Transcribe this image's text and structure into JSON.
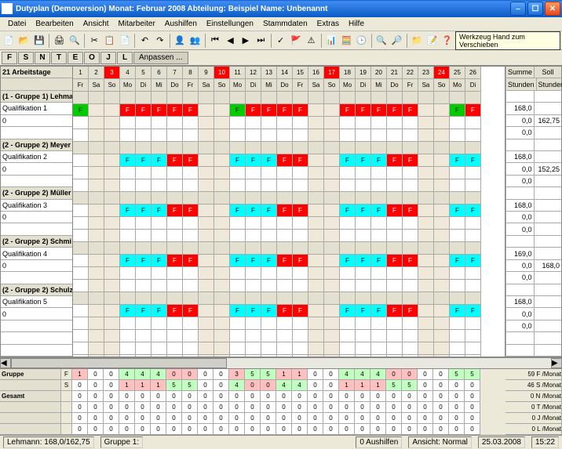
{
  "title": "Dutyplan (Demoversion)  Monat: Februar 2008  Abteilung: Beispiel  Name: Unbenannt",
  "menu": [
    "Datei",
    "Bearbeiten",
    "Ansicht",
    "Mitarbeiter",
    "Aushilfen",
    "Einstellungen",
    "Stammdaten",
    "Extras",
    "Hilfe"
  ],
  "toolbar_tip": "Werkzeug Hand zum Verschieben",
  "filters": [
    "F",
    "S",
    "N",
    "T",
    "E",
    "O",
    "J",
    "L",
    "Anpassen ..."
  ],
  "workdays_label": "21 Arbeitstage",
  "day_nums": [
    "1",
    "2",
    "3",
    "4",
    "5",
    "6",
    "7",
    "8",
    "9",
    "10",
    "11",
    "12",
    "13",
    "14",
    "15",
    "16",
    "17",
    "18",
    "19",
    "20",
    "21",
    "22",
    "23",
    "24",
    "25",
    "26"
  ],
  "day_wd": [
    "Fr",
    "Sa",
    "So",
    "Mo",
    "Di",
    "Mi",
    "Do",
    "Fr",
    "Sa",
    "So",
    "Mo",
    "Di",
    "Mi",
    "Do",
    "Fr",
    "Sa",
    "So",
    "Mo",
    "Di",
    "Mi",
    "Do",
    "Fr",
    "Sa",
    "So",
    "Mo",
    "Di"
  ],
  "day_red": [
    0,
    0,
    1,
    0,
    0,
    0,
    0,
    0,
    0,
    1,
    0,
    0,
    0,
    0,
    0,
    0,
    1,
    0,
    0,
    0,
    0,
    0,
    0,
    1,
    0,
    0
  ],
  "sum_hdr": [
    "Summe",
    "Soll"
  ],
  "hours_hdr_left": "Stunden",
  "hours_hdr_right": "Stunden",
  "groups": [
    {
      "name": "(1 - Gruppe 1) Lehma",
      "sum": "",
      "soll": "",
      "rows": [
        {
          "label": "Qualifikation 1",
          "cells": [
            "F",
            "",
            "",
            "F",
            "F",
            "F",
            "F",
            "F",
            "",
            "",
            "F",
            "F",
            "F",
            "F",
            "F",
            "",
            "",
            "F",
            "F",
            "F",
            "F",
            "F",
            "",
            "",
            "F",
            "F"
          ],
          "cls": [
            "green",
            "",
            "",
            "red",
            "red",
            "red",
            "red",
            "red",
            "",
            "",
            "green",
            "red",
            "red",
            "red",
            "red",
            "",
            "",
            "red",
            "red",
            "red",
            "red",
            "red",
            "",
            "",
            "green",
            "red"
          ],
          "sum": "168,0",
          "soll": ""
        },
        {
          "label": "0",
          "cells": [],
          "sum": "0,0",
          "soll": "162,75"
        },
        {
          "label": "",
          "cells": [],
          "sum": "0,0",
          "soll": ""
        }
      ]
    },
    {
      "name": "(2 - Gruppe 2) Meyer",
      "sum": "",
      "soll": "",
      "rows": [
        {
          "label": "Qualifikation 2",
          "cells": [
            "",
            "",
            "",
            "F",
            "F",
            "F",
            "F",
            "F",
            "",
            "",
            "F",
            "F",
            "F",
            "F",
            "F",
            "",
            "",
            "F",
            "F",
            "F",
            "F",
            "F",
            "",
            "",
            "F",
            "F"
          ],
          "cls": [
            "",
            "",
            "",
            "cyan",
            "cyan",
            "cyan",
            "red",
            "red",
            "",
            "",
            "cyan",
            "cyan",
            "cyan",
            "red",
            "red",
            "",
            "",
            "cyan",
            "cyan",
            "cyan",
            "red",
            "red",
            "",
            "",
            "cyan",
            "cyan"
          ],
          "sum": "168,0",
          "soll": ""
        },
        {
          "label": "0",
          "cells": [],
          "sum": "0,0",
          "soll": "152,25"
        },
        {
          "label": "",
          "cells": [],
          "sum": "0,0",
          "soll": ""
        }
      ]
    },
    {
      "name": "(2 - Gruppe 2) Müller",
      "sum": "",
      "soll": "",
      "rows": [
        {
          "label": "Qualifikation 3",
          "cells": [
            "",
            "",
            "",
            "F",
            "F",
            "F",
            "F",
            "F",
            "",
            "",
            "F",
            "F",
            "F",
            "F",
            "F",
            "",
            "",
            "F",
            "F",
            "F",
            "F",
            "F",
            "",
            "",
            "F",
            "F"
          ],
          "cls": [
            "",
            "",
            "",
            "cyan",
            "cyan",
            "cyan",
            "red",
            "red",
            "",
            "",
            "cyan",
            "cyan",
            "cyan",
            "red",
            "red",
            "",
            "",
            "cyan",
            "cyan",
            "cyan",
            "red",
            "red",
            "",
            "",
            "cyan",
            "cyan"
          ],
          "sum": "168,0",
          "soll": ""
        },
        {
          "label": "0",
          "cells": [],
          "sum": "0,0",
          "soll": ""
        },
        {
          "label": "",
          "cells": [],
          "sum": "0,0",
          "soll": ""
        }
      ]
    },
    {
      "name": "(2 - Gruppe 2) Schmi",
      "sum": "",
      "soll": "",
      "rows": [
        {
          "label": "Qualifikation 4",
          "cells": [
            "",
            "",
            "",
            "F",
            "F",
            "F",
            "F",
            "F",
            "",
            "",
            "F",
            "F",
            "F",
            "F",
            "F",
            "",
            "",
            "F",
            "F",
            "F",
            "F",
            "F",
            "",
            "",
            "F",
            "F"
          ],
          "cls": [
            "",
            "",
            "",
            "cyan",
            "cyan",
            "cyan",
            "red",
            "red",
            "",
            "",
            "cyan",
            "cyan",
            "cyan",
            "red",
            "red",
            "",
            "",
            "cyan",
            "cyan",
            "cyan",
            "red",
            "red",
            "",
            "",
            "cyan",
            "cyan"
          ],
          "sum": "169,0",
          "soll": ""
        },
        {
          "label": "0",
          "cells": [],
          "sum": "0,0",
          "soll": "168,0"
        },
        {
          "label": "",
          "cells": [],
          "sum": "0,0",
          "soll": ""
        }
      ]
    },
    {
      "name": "(2 - Gruppe 2) Schulz",
      "sum": "",
      "soll": "",
      "rows": [
        {
          "label": "Qualifikation 5",
          "cells": [
            "",
            "",
            "",
            "F",
            "F",
            "F",
            "F",
            "F",
            "",
            "",
            "F",
            "F",
            "F",
            "F",
            "F",
            "",
            "",
            "F",
            "F",
            "F",
            "F",
            "F",
            "",
            "",
            "F",
            "F"
          ],
          "cls": [
            "",
            "",
            "",
            "cyan",
            "cyan",
            "cyan",
            "red",
            "red",
            "",
            "",
            "cyan",
            "cyan",
            "cyan",
            "red",
            "red",
            "",
            "",
            "cyan",
            "cyan",
            "cyan",
            "red",
            "red",
            "",
            "",
            "cyan",
            "cyan"
          ],
          "sum": "168,0",
          "soll": ""
        },
        {
          "label": "0",
          "cells": [],
          "sum": "0,0",
          "soll": ""
        },
        {
          "label": "",
          "cells": [],
          "sum": "0,0",
          "soll": ""
        },
        {
          "label": "",
          "cells": [],
          "sum": "",
          "soll": ""
        },
        {
          "label": "",
          "cells": [],
          "sum": "",
          "soll": ""
        }
      ]
    }
  ],
  "summary": {
    "labels": [
      "Gruppe",
      "",
      "Gesamt",
      "",
      "",
      ""
    ],
    "codes": [
      "F",
      "S"
    ],
    "grid": [
      {
        "label": "F",
        "vals": [
          "1",
          "0",
          "0",
          "4",
          "4",
          "4",
          "0",
          "0",
          "0",
          "0",
          "3",
          "5",
          "5",
          "1",
          "1",
          "0",
          "0",
          "4",
          "4",
          "4",
          "0",
          "0",
          "0",
          "0",
          "5",
          "5"
        ],
        "cls": [
          "pink",
          "",
          "",
          "lgreen",
          "lgreen",
          "lgreen",
          "pink",
          "pink",
          "",
          "",
          "pink",
          "lgreen",
          "lgreen",
          "pink",
          "pink",
          "",
          "",
          "lgreen",
          "lgreen",
          "lgreen",
          "pink",
          "pink",
          "",
          "",
          "lgreen",
          "lgreen"
        ],
        "right": "59 F /Monat"
      },
      {
        "label": "S",
        "vals": [
          "0",
          "0",
          "0",
          "1",
          "1",
          "1",
          "5",
          "5",
          "0",
          "0",
          "4",
          "0",
          "0",
          "4",
          "4",
          "0",
          "0",
          "1",
          "1",
          "1",
          "5",
          "5",
          "0",
          "0",
          "0",
          "0"
        ],
        "cls": [
          "",
          "",
          "",
          "pink",
          "pink",
          "pink",
          "lgreen",
          "lgreen",
          "",
          "",
          "lgreen",
          "pink",
          "pink",
          "lgreen",
          "lgreen",
          "",
          "",
          "pink",
          "pink",
          "pink",
          "lgreen",
          "lgreen",
          "",
          "",
          "",
          ""
        ],
        "right": "46 S /Monat"
      },
      {
        "label": "",
        "vals": [
          "0",
          "0",
          "0",
          "0",
          "0",
          "0",
          "0",
          "0",
          "0",
          "0",
          "0",
          "0",
          "0",
          "0",
          "0",
          "0",
          "0",
          "0",
          "0",
          "0",
          "0",
          "0",
          "0",
          "0",
          "0",
          "0"
        ],
        "cls": [],
        "right": "0 N /Monat"
      },
      {
        "label": "",
        "vals": [
          "0",
          "0",
          "0",
          "0",
          "0",
          "0",
          "0",
          "0",
          "0",
          "0",
          "0",
          "0",
          "0",
          "0",
          "0",
          "0",
          "0",
          "0",
          "0",
          "0",
          "0",
          "0",
          "0",
          "0",
          "0",
          "0"
        ],
        "cls": [],
        "right": "0 T /Monat"
      },
      {
        "label": "",
        "vals": [
          "0",
          "0",
          "0",
          "0",
          "0",
          "0",
          "0",
          "0",
          "0",
          "0",
          "0",
          "0",
          "0",
          "0",
          "0",
          "0",
          "0",
          "0",
          "0",
          "0",
          "0",
          "0",
          "0",
          "0",
          "0",
          "0"
        ],
        "cls": [],
        "right": "0 J /Monat"
      },
      {
        "label": "",
        "vals": [
          "0",
          "0",
          "0",
          "0",
          "0",
          "0",
          "0",
          "0",
          "0",
          "0",
          "0",
          "0",
          "0",
          "0",
          "0",
          "0",
          "0",
          "0",
          "0",
          "0",
          "0",
          "0",
          "0",
          "0",
          "0",
          "0"
        ],
        "cls": [],
        "right": "0 L /Monat"
      }
    ]
  },
  "status": {
    "left": "Lehmann: 168,0/162,75",
    "group": "Gruppe 1:",
    "aushilfen": "0 Aushilfen",
    "view": "Ansicht: Normal",
    "date": "25.03.2008",
    "time": "15:22"
  }
}
